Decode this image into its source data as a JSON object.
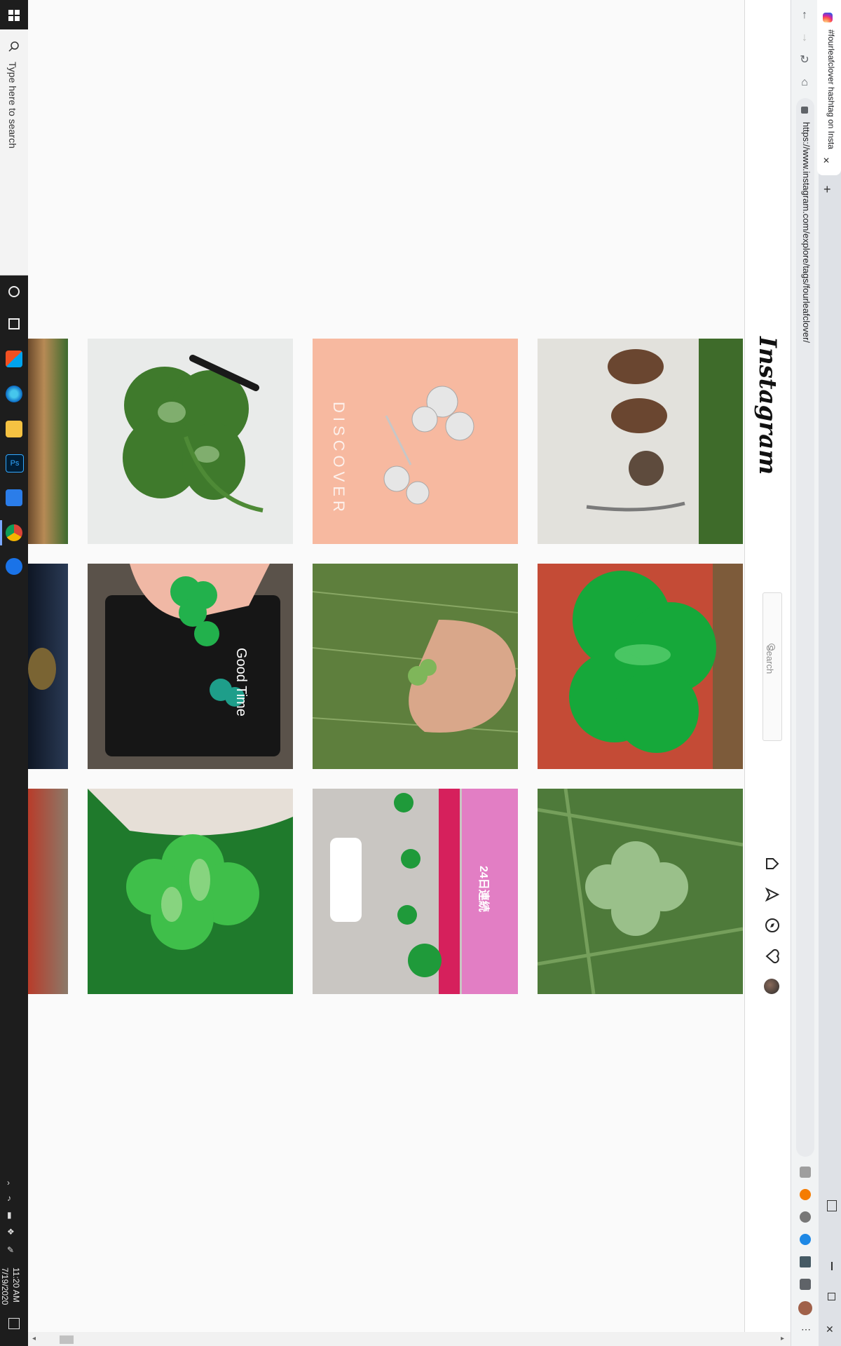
{
  "taskbar": {
    "search_placeholder": "Type here to search",
    "clock_time": "11:20 AM",
    "clock_date": "7/19/2020",
    "apps": [
      "store-icon",
      "edge-icon",
      "file-explorer-icon",
      "photoshop-icon",
      "app-icon",
      "chrome-icon",
      "settings-icon"
    ]
  },
  "browser": {
    "tab_title": "#fourleafclover hashtag on Insta",
    "url": "https://www.instagram.com/explore/tags/fourleafclover/",
    "new_tab": "+",
    "close_tab": "✕",
    "window_close": "✕"
  },
  "instagram": {
    "logo": "Instagram",
    "search_placeholder": "Search"
  },
  "grid": {
    "posts": [
      {
        "subject": "watercolor four-leaf clover painting"
      },
      {
        "subject": "silver clover earrings",
        "overlay_text": "DISCOVER"
      },
      {
        "subject": "copper clover charms"
      },
      {
        "subject": "green clover beads on wallet",
        "overlay_text": "Good Time"
      },
      {
        "subject": "hand picking clover in grass"
      },
      {
        "subject": "painted metal clover"
      },
      {
        "subject": "clover held in hand"
      },
      {
        "subject": "four-leaf clovers collection",
        "overlay_text": "24日連続"
      },
      {
        "subject": "clover in grass"
      }
    ]
  },
  "colors": {
    "accent_peach": "#f7b9a0",
    "clover_green": "#2e9a3c",
    "taskbar": "#1d1d1d"
  }
}
